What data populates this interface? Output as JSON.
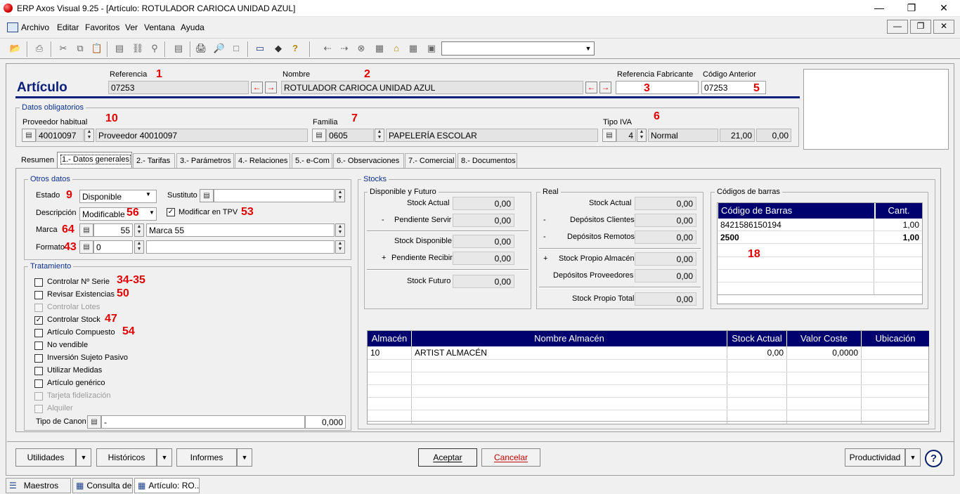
{
  "window": {
    "title": "ERP Axos Visual 9.25 - [Artículo: ROTULADOR CARIOCA UNIDAD AZUL]"
  },
  "menu": [
    "Archivo",
    "Editar",
    "Favoritos",
    "Ver",
    "Ventana",
    "Ayuda"
  ],
  "header": {
    "title": "Artículo",
    "referencia_label": "Referencia",
    "referencia": "07253",
    "nombre_label": "Nombre",
    "nombre": "ROTULADOR CARIOCA UNIDAD AZUL",
    "ref_fab_label": "Referencia Fabricante",
    "ref_fab": "",
    "cod_ant_label": "Código Anterior",
    "cod_ant": "07253"
  },
  "datos": {
    "group_label": "Datos obligatorios",
    "proveedor_label": "Proveedor habitual",
    "proveedor_code": "40010097",
    "proveedor_name": "Proveedor 40010097",
    "familia_label": "Familia",
    "familia_code": "0605",
    "familia_name": "PAPELERÍA ESCOLAR",
    "iva_label": "Tipo IVA",
    "iva_code": "4",
    "iva_name": "Normal",
    "iva_pct": "21,00",
    "iva_rec": "0,00"
  },
  "tabs": [
    "Resumen",
    "1.- Datos generales",
    "2.- Tarifas",
    "3.- Parámetros",
    "4.- Relaciones",
    "5.- e-Com",
    "6.- Observaciones",
    "7.- Comercial",
    "8.- Documentos"
  ],
  "otros": {
    "group_label": "Otros datos",
    "estado_label": "Estado",
    "estado": "Disponible",
    "sustituto_label": "Sustituto",
    "sustituto": "",
    "descripcion_label": "Descripción",
    "descripcion": "Modificable",
    "tpv_label": "Modificar en TPV",
    "marca_label": "Marca",
    "marca_code": "55",
    "marca_name": "Marca 55",
    "formato_label": "Formato",
    "formato_code": "0",
    "formato_name": ""
  },
  "tratamiento": {
    "group_label": "Tratamiento",
    "items": [
      {
        "label": "Controlar Nº Serie",
        "checked": false,
        "enabled": true
      },
      {
        "label": "Revisar Existencias",
        "checked": false,
        "enabled": true
      },
      {
        "label": "Controlar Lotes",
        "checked": false,
        "enabled": false
      },
      {
        "label": "Controlar Stock",
        "checked": true,
        "enabled": true
      },
      {
        "label": "Artículo Compuesto",
        "checked": false,
        "enabled": true
      },
      {
        "label": "No vendible",
        "checked": false,
        "enabled": true
      },
      {
        "label": "Inversión Sujeto Pasivo",
        "checked": false,
        "enabled": true
      },
      {
        "label": "Utilizar Medidas",
        "checked": false,
        "enabled": true
      },
      {
        "label": "Artículo genérico",
        "checked": false,
        "enabled": true
      },
      {
        "label": "Tarjeta fidelización",
        "checked": false,
        "enabled": false
      },
      {
        "label": "Alquiler",
        "checked": false,
        "enabled": false
      }
    ],
    "canon_label": "Tipo de Canon",
    "canon": "-",
    "canon_value": "0,000"
  },
  "stocks": {
    "group_label": "Stocks",
    "disponible_label": "Disponible y Futuro",
    "stock_actual_label": "Stock Actual",
    "stock_actual": "0,00",
    "pend_servir_sign": "-",
    "pend_servir_label": "Pendiente Servir",
    "pend_servir": "0,00",
    "stock_disp_label": "Stock Disponible",
    "stock_disp": "0,00",
    "pend_recibir_sign": "+",
    "pend_recibir_label": "Pendiente Recibir",
    "pend_recibir": "0,00",
    "stock_futuro_label": "Stock Futuro",
    "stock_futuro": "0,00",
    "real_label": "Real",
    "real_stock_actual_label": "Stock Actual",
    "real_stock_actual": "0,00",
    "dep_clientes_sign": "-",
    "dep_clientes_label": "Depósitos Clientes",
    "dep_clientes": "0,00",
    "dep_remotos_sign": "-",
    "dep_remotos_label": "Depósitos Remotos",
    "dep_remotos": "0,00",
    "propio_alm_sign": "+",
    "propio_alm_label": "Stock Propio Almacén",
    "propio_alm": "0,00",
    "dep_prov_label": "Depósitos Proveedores",
    "dep_prov": "0,00",
    "propio_total_label": "Stock Propio Total",
    "propio_total": "0,00"
  },
  "barcodes": {
    "group_label": "Códigos de barras",
    "headers": [
      "Código de Barras",
      "Cant."
    ],
    "rows": [
      {
        "code": "8421586150194",
        "qty": "1,00"
      },
      {
        "code": "2500",
        "qty": "1,00"
      }
    ]
  },
  "almacenes": {
    "headers": [
      "Almacén",
      "Nombre Almacén",
      "Stock Actual",
      "Valor Coste",
      "Ubicación"
    ],
    "rows": [
      {
        "id": "10",
        "name": "ARTIST ALMACÉN",
        "stock": "0,00",
        "coste": "0,0000",
        "ubic": ""
      }
    ]
  },
  "annotations": {
    "a1": "1",
    "a2": "2",
    "a3": "3",
    "a5": "5",
    "a10": "10",
    "a7": "7",
    "a6": "6",
    "a9": "9",
    "a56": "56",
    "a53": "53",
    "a64": "64",
    "a43": "43",
    "a34": "34-35",
    "a50": "50",
    "a47": "47",
    "a54": "54",
    "a18": "18"
  },
  "footer": {
    "utilidades": "Utilidades",
    "historicos": "Históricos",
    "informes": "Informes",
    "aceptar": "Aceptar",
    "cancelar": "Cancelar",
    "productividad": "Productividad"
  },
  "taskbar": [
    "Maestros",
    "Consulta de...",
    "Artículo: RO..."
  ]
}
